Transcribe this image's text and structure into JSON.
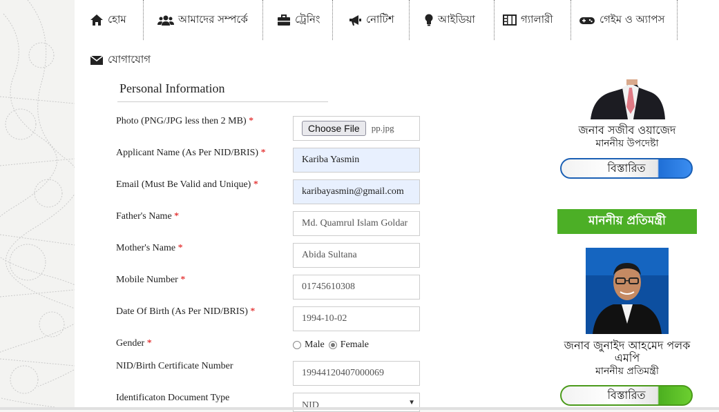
{
  "nav": {
    "items": [
      {
        "label": "হোম",
        "icon": "home-icon"
      },
      {
        "label": "আমাদের সম্পর্কে",
        "icon": "users-icon"
      },
      {
        "label": "ট্রেনিং",
        "icon": "briefcase-icon"
      },
      {
        "label": "নোটিশ",
        "icon": "megaphone-icon"
      },
      {
        "label": "আইডিয়া",
        "icon": "lightbulb-icon"
      },
      {
        "label": "গ্যালারী",
        "icon": "film-icon"
      },
      {
        "label": "গেইম ও অ্যাপস",
        "icon": "gamepad-icon"
      },
      {
        "label": "যোগাযোগ",
        "icon": "envelope-icon"
      }
    ]
  },
  "form": {
    "section_title": "Personal Information",
    "required_mark": "*",
    "photo": {
      "label": "Photo (PNG/JPG less then 2 MB)",
      "button": "Choose File",
      "file_name": "pp.jpg"
    },
    "applicant_name": {
      "label": "Applicant Name (As Per NID/BRIS)",
      "value": "Kariba Yasmin"
    },
    "email": {
      "label": "Email (Must Be Valid and Unique)",
      "value": "karibayasmin@gmail.com"
    },
    "father_name": {
      "label": "Father's Name",
      "value": "Md. Quamrul Islam Goldar"
    },
    "mother_name": {
      "label": "Mother's Name",
      "value": "Abida Sultana"
    },
    "mobile": {
      "label": "Mobile Number",
      "value": "01745610308"
    },
    "dob": {
      "label": "Date Of Birth (As Per NID/BRIS)",
      "value": "1994-10-02"
    },
    "gender": {
      "label": "Gender",
      "options": [
        "Male",
        "Female"
      ],
      "selected": "Female"
    },
    "nid": {
      "label": "NID/Birth Certificate Number",
      "value": "19944120407000069"
    },
    "id_doc_type": {
      "label": "Identificaton Document Type",
      "value": "NID"
    }
  },
  "sidebar": {
    "advisor": {
      "name": "জনাব সজীব ওয়াজেদ",
      "role": "মাননীয় উপদেষ্টা",
      "button": "বিস্তারিত"
    },
    "minister_header": "মাননীয় প্রতিমন্ত্রী",
    "minister": {
      "name_line1": "জনাব জুনাইদ আহমেদ পলক",
      "name_line2": "এমপি",
      "role": "মাননীয় প্রতিমন্ত্রী",
      "button": "বিস্তারিত"
    }
  },
  "colors": {
    "accent_green": "#4caf26",
    "accent_blue": "#1f6fd6",
    "required": "#dd0000",
    "autofill": "#e8f0fe"
  }
}
